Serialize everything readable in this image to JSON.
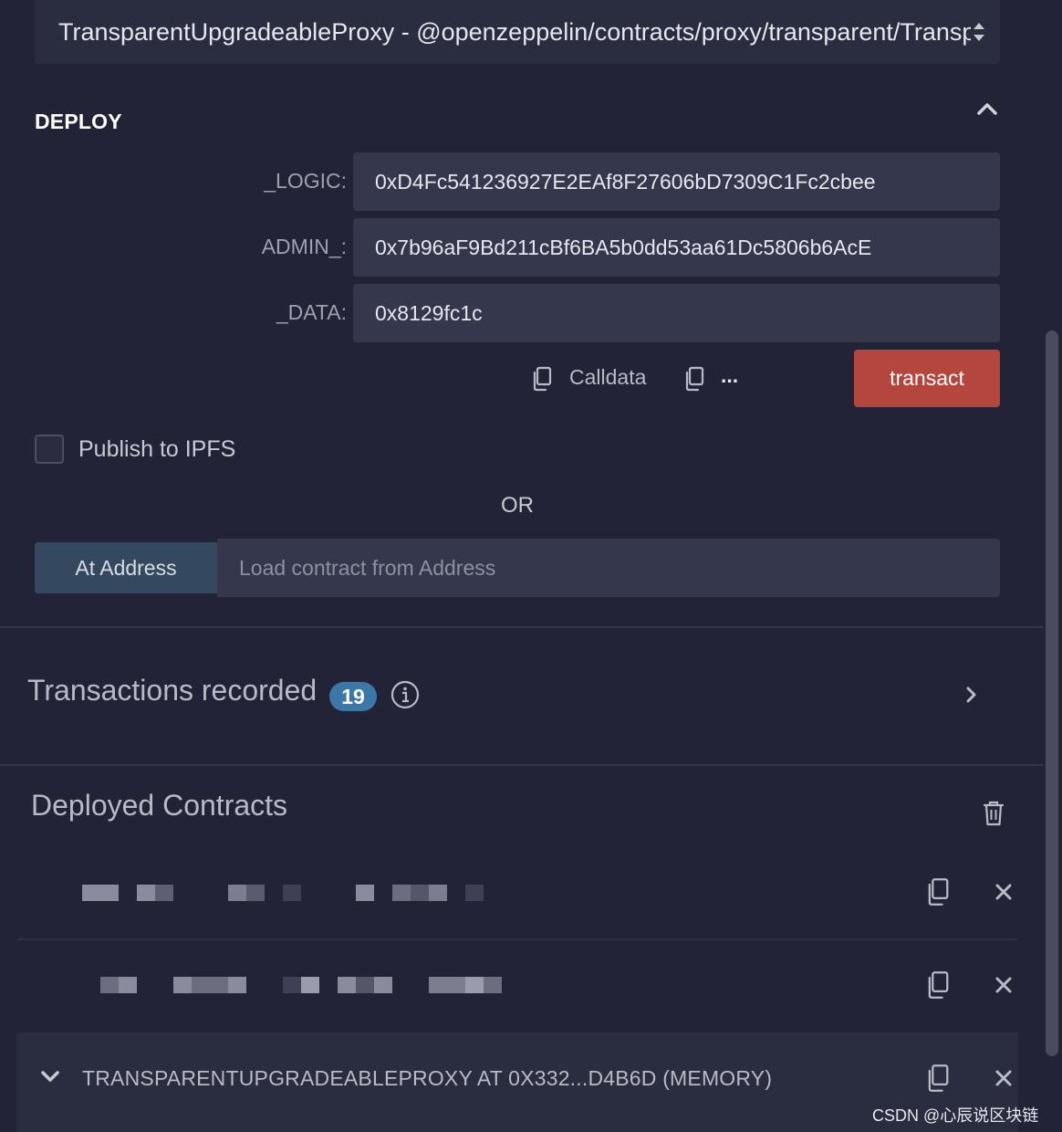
{
  "contract_select": {
    "value": "TransparentUpgradeableProxy - @openzeppelin/contracts/proxy/transparent/TransparentUpgradeableProxy.sol"
  },
  "deploy": {
    "title": "DEPLOY",
    "params": [
      {
        "label": "_LOGIC:",
        "value": "0xD4Fc541236927E2EAf8F27606bD7309C1Fc2cbee"
      },
      {
        "label": "ADMIN_:",
        "value": "0x7b96aF9Bd211cBf6BA5b0dd53aa61Dc5806b6AcE"
      },
      {
        "label": "_DATA:",
        "value": "0x8129fc1c"
      }
    ],
    "calldata_label": "Calldata",
    "ellipsis_label": "...",
    "transact_label": "transact"
  },
  "publish": {
    "label": "Publish to IPFS",
    "checked": false
  },
  "or_label": "OR",
  "at_address": {
    "button_label": "At Address",
    "placeholder": "Load contract from Address"
  },
  "transactions": {
    "title": "Transactions recorded",
    "count": "19"
  },
  "deployed": {
    "title": "Deployed Contracts",
    "expanded_item_label": "TRANSPARENTUPGRADEABLEPROXY AT 0X332...D4B6D (MEMORY)"
  },
  "watermark": "CSDN @心辰说区块链",
  "colors": {
    "background": "#222336",
    "input_bg": "#35374d",
    "transact": "#b4463e",
    "at_address": "#34495f",
    "badge": "#3b78a8"
  }
}
